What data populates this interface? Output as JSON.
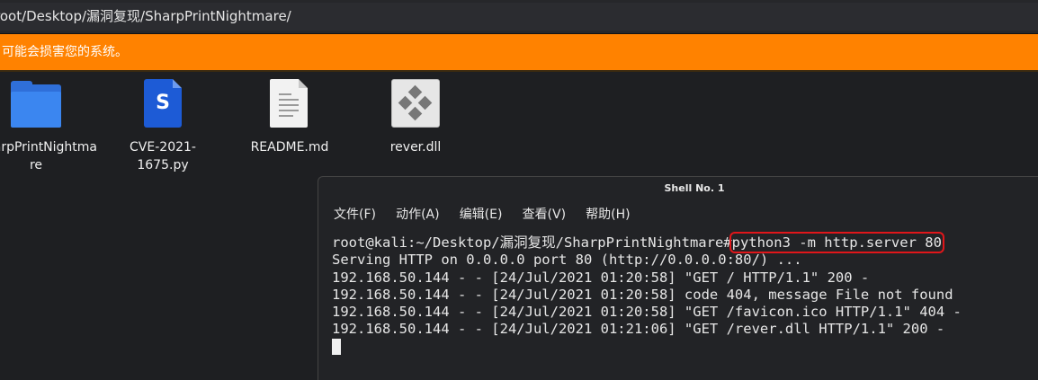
{
  "path_bar": {
    "path": "root/Desktop/漏洞复现/SharpPrintNightmare/"
  },
  "warning_bar": {
    "text": "可能会损害您的系统。"
  },
  "files": [
    {
      "name": "SharpPrintNightma\nre",
      "icon": "folder-icon"
    },
    {
      "name": "CVE-2021-1675.py",
      "icon": "python-file-icon"
    },
    {
      "name": "README.md",
      "icon": "text-file-icon"
    },
    {
      "name": "rever.dll",
      "icon": "dll-file-icon"
    }
  ],
  "terminal": {
    "title": "Shell No. 1",
    "menu": [
      "文件(F)",
      "动作(A)",
      "编辑(E)",
      "查看(V)",
      "帮助(H)"
    ],
    "prompt": "root@kali:~/Desktop/漏洞复现/SharpPrintNightmare#",
    "command": "python3 -m http.server 80",
    "lines": [
      "Serving HTTP on 0.0.0.0 port 80 (http://0.0.0.0:80/) ...",
      "192.168.50.144 - - [24/Jul/2021 01:20:58] \"GET / HTTP/1.1\" 200 -",
      "192.168.50.144 - - [24/Jul/2021 01:20:58] code 404, message File not found",
      "192.168.50.144 - - [24/Jul/2021 01:20:58] \"GET /favicon.ico HTTP/1.1\" 404 -",
      "192.168.50.144 - - [24/Jul/2021 01:21:06] \"GET /rever.dll HTTP/1.1\" 200 -"
    ]
  },
  "colors": {
    "warning": "#ff8200",
    "highlight": "#e0161a",
    "folder": "#3b86f0"
  }
}
